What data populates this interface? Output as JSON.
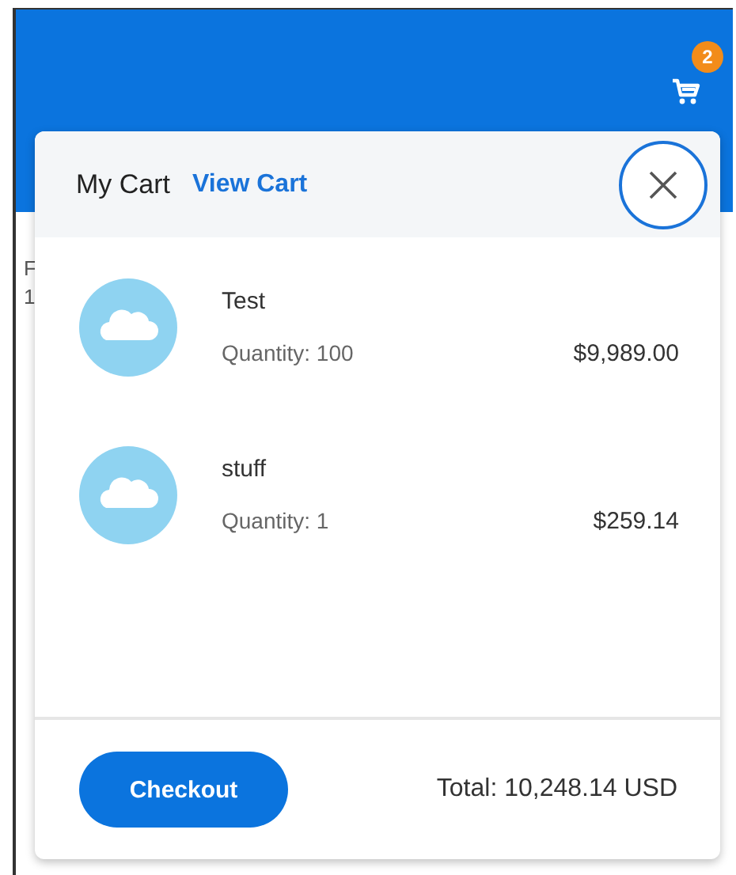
{
  "header": {
    "cart_count": "2"
  },
  "background_text": [
    "F",
    "1"
  ],
  "cart": {
    "title": "My Cart",
    "view_link": "View Cart",
    "items": [
      {
        "name": "Test",
        "quantity": "Quantity: 100",
        "price": "$9,989.00"
      },
      {
        "name": "stuff",
        "quantity": "Quantity: 1",
        "price": "$259.14"
      }
    ],
    "checkout": "Checkout",
    "total": "Total: 10,248.14 USD"
  }
}
